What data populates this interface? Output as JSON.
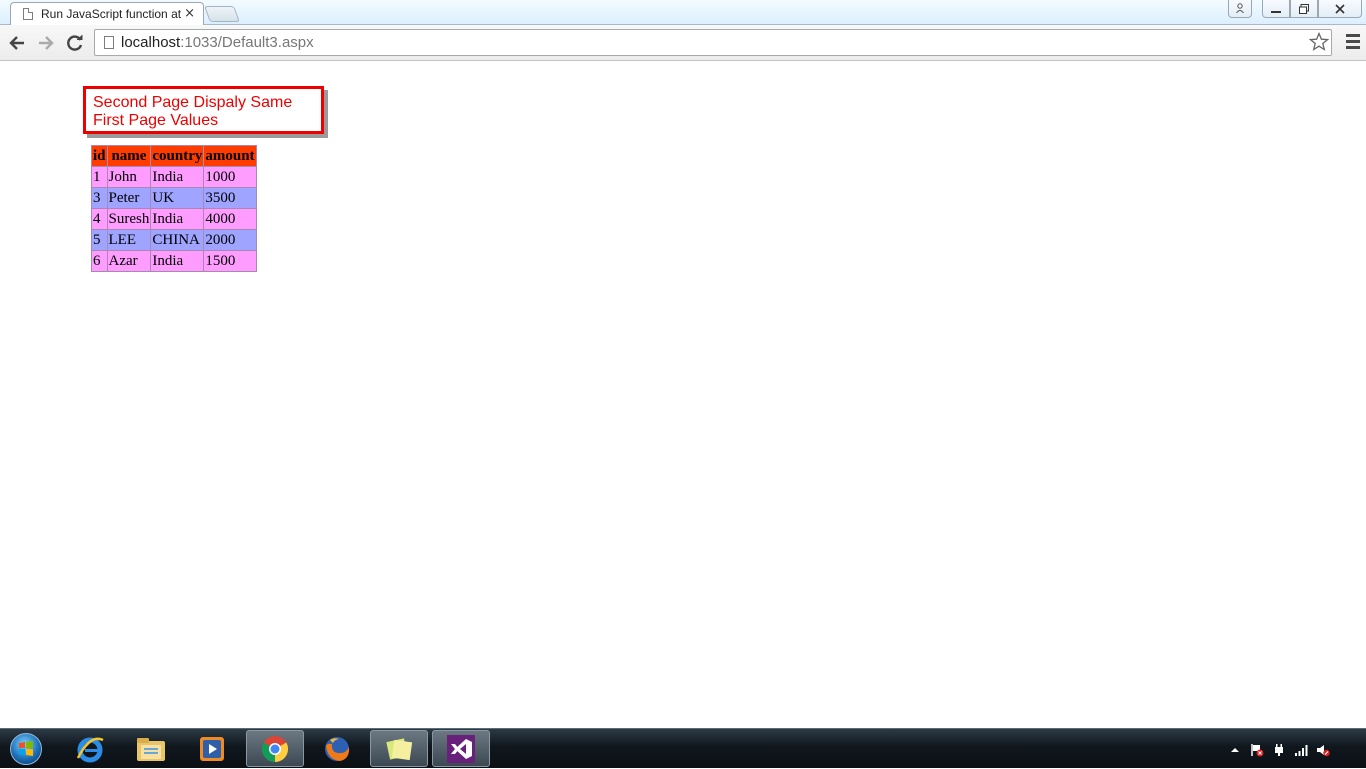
{
  "browser": {
    "tab_title": "Run JavaScript function at",
    "tab_close": "×",
    "url_host": "localhost",
    "url_rest": ":1033/Default3.aspx"
  },
  "page": {
    "message_line1": "Second Page Dispaly Same",
    "message_line2": "First Page Values",
    "table": {
      "headers": [
        "id",
        "name",
        "country",
        "amount"
      ],
      "rows": [
        [
          "1",
          "John",
          "India",
          "1000"
        ],
        [
          "3",
          "Peter",
          "UK",
          "3500"
        ],
        [
          "4",
          "Suresh",
          "India",
          "4000"
        ],
        [
          "5",
          "LEE",
          "CHINA",
          "2000"
        ],
        [
          "6",
          "Azar",
          "India",
          "1500"
        ]
      ]
    }
  },
  "colors": {
    "header_bg": "#ff3c00",
    "row_odd_bg": "#ff9cff",
    "row_even_bg": "#9ea4ff",
    "message_red": "#ee0000"
  },
  "taskbar": {
    "items": [
      "internet-explorer-icon",
      "file-explorer-icon",
      "media-player-icon",
      "chrome-icon",
      "firefox-icon",
      "sticky-notes-icon",
      "visual-studio-icon"
    ]
  }
}
